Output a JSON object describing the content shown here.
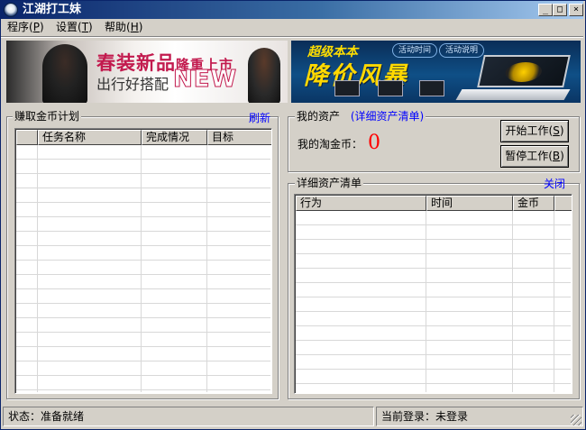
{
  "window": {
    "title": "江湖打工妹",
    "min_glyph": "_",
    "max_glyph": "□",
    "close_glyph": "×"
  },
  "menu": [
    {
      "label": "程序",
      "key": "P"
    },
    {
      "label": "设置",
      "key": "T"
    },
    {
      "label": "帮助",
      "key": "H"
    }
  ],
  "banners": {
    "left": {
      "headline": "春装新品",
      "headline_small": "隆重上市",
      "sub": "出行好搭配",
      "tag": "NEW"
    },
    "right": {
      "tag": "超级本本",
      "headline": "降价风暴",
      "pills": [
        "活动时间",
        "活动说明"
      ]
    }
  },
  "plan": {
    "title": "赚取金币计划",
    "refresh": "刷新",
    "columns": [
      "任务名称",
      "完成情况",
      "目标"
    ]
  },
  "assets": {
    "title": "我的资产",
    "detail_link": "(详细资产清单)",
    "coins_label": "我的淘金币：",
    "coins_value": "0",
    "start_button": {
      "label": "开始工作",
      "key": "S"
    },
    "pause_button": {
      "label": "暂停工作",
      "key": "B"
    }
  },
  "detail": {
    "title": "详细资产清单",
    "close": "关闭",
    "columns": [
      "行为",
      "时间",
      "金币"
    ]
  },
  "status": {
    "left": "状态：准备就绪",
    "right": "当前登录：未登录"
  }
}
